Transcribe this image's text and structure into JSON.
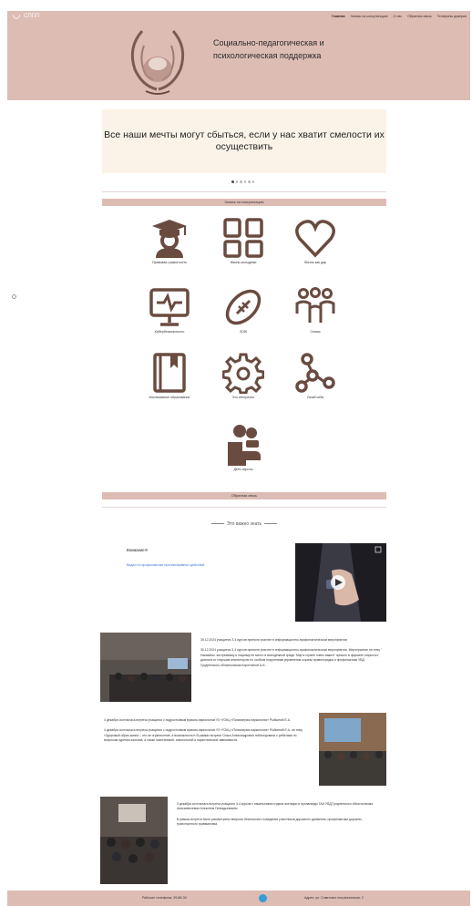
{
  "header": {
    "brand": "СППП",
    "nav": [
      "Главная",
      "Запись на консультацию",
      "О нас",
      "Обратная связь",
      "Телефоны доверия"
    ],
    "title": "Социально-педагогическая и психологическая поддержка"
  },
  "banner": {
    "quote": "Все наши мечты могут сбыться, если у нас хватит смелости их осуществить",
    "slides": 6,
    "active_slide": 1
  },
  "consult_bar": "Запись на консультацию",
  "tiles": [
    {
      "label": "Правовая грамотность",
      "icon": "graduate-icon"
    },
    {
      "label": "Жизнь молодёжи",
      "icon": "dashboard-icon"
    },
    {
      "label": "Жизнь как дар",
      "icon": "heart-icon"
    },
    {
      "label": "Кибербезопасность",
      "icon": "monitor-pulse-icon"
    },
    {
      "label": "ЗОЖ",
      "icon": "football-icon"
    },
    {
      "label": "Семья",
      "icon": "family-icon"
    },
    {
      "label": "Инклюзивное образование",
      "icon": "book-bookmark-icon"
    },
    {
      "label": "Это интересно",
      "icon": "gear-icon"
    },
    {
      "label": "Узнай себя",
      "icon": "molecule-icon"
    },
    {
      "label": "Дети-сироты",
      "icon": "child-support-icon"
    }
  ],
  "feedback_bar": "Обратная связь",
  "important": "Это важно знать",
  "attention": {
    "title": "Внимание!!!",
    "link": "Видео по профилактике противоправных действий"
  },
  "news": [
    {
      "paragraphs": [
        "30.12.2024 учащиеся 3-4 курсов приняли участие в информационно-профилактическом мероприятии",
        "30.12.2024 учащиеся 3-4 курсов приняли участие в информационно-профилактическом мероприятии. Мероприятие на тему \" Наказаны: экстремизму и нацизму не место в молодёжной среде. Мир в стране очень важен\" прошло в формате открытого диалога со старшим инспектором по особым поручениям управления охраны правопорядка и профилактики УВД Гродненского облисполкома Коротчиной А.И."
      ]
    },
    {
      "paragraphs": [
        "4 декабря состоялась встреча учащихся с подростковым врачом-наркологом УЗ «ГОКЦ «Психиатрия-наркология» Рыбкиной Е.А.",
        "4 декабря состоялась встреча учащихся с подростковым врачом-наркологом УЗ «ГОКЦ «Психиатрия-наркология» Рыбкиной Е.А. на тему «Здоровый образ жизни – это не ограничение, а возможность!» В рамках встречи Ольга Александровна побеседовала с ребятами по вопросам курения кальяна, а также никотиновой, алкогольной и наркотической зависимости."
      ]
    },
    {
      "paragraphs": [
        "3 декабря состоялась встреча учащихся 3-4 курсов с начальником отдела агитации и пропаганды ГАИ УВД Гродненского облисполкома Анисьевичевом Алексеем Геннадьевичем",
        "В рамках встречи были рассмотрены вопросы безопасного поведения участников дорожного движения, профилактики дорожно-транспортного травматизма."
      ]
    }
  ],
  "footer": {
    "hours": "Рабочие телефоны: 39-86-00",
    "address": "Адрес: ул. Советских пограничников, 2"
  },
  "colors": {
    "header": "#ddbcb4",
    "icon": "#6a4b40",
    "banner": "#fbf3e7",
    "link": "#3b7ad9"
  }
}
